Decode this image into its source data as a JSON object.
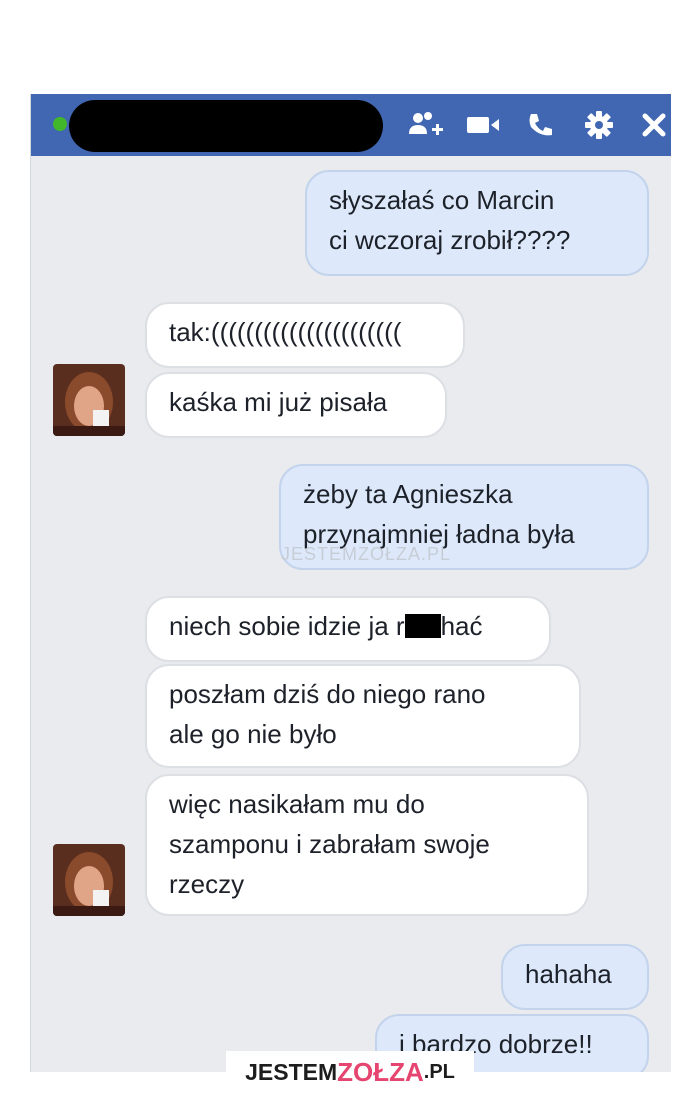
{
  "header": {
    "contact_name": "",
    "icons": [
      "add-person-icon",
      "video-call-icon",
      "phone-call-icon",
      "settings-gear-icon",
      "close-icon"
    ]
  },
  "messages": [
    {
      "side": "out",
      "lines": [
        "słyszałaś co Marcin",
        "ci wczoraj zrobił????"
      ]
    },
    {
      "side": "in",
      "lines": [
        "tak:(((((((((((((((((((((("
      ]
    },
    {
      "side": "in",
      "lines": [
        "kaśka mi już pisała"
      ]
    },
    {
      "side": "out",
      "lines": [
        "żeby ta Agnieszka",
        "przynajmniej ładna była"
      ]
    },
    {
      "side": "in",
      "lines": [
        "niech sobie idzie ja r",
        "hać"
      ]
    },
    {
      "side": "in",
      "lines": [
        "poszłam dziś do niego rano",
        "ale go nie było"
      ]
    },
    {
      "side": "in",
      "lines": [
        "więc nasikałam mu do",
        "szamponu i zabrałam swoje",
        "rzeczy"
      ]
    },
    {
      "side": "out",
      "lines": [
        "hahaha"
      ]
    },
    {
      "side": "out",
      "lines": [
        "i bardzo dobrze!!"
      ]
    }
  ],
  "watermark": "JESTEMZOŁZA.PL",
  "logo": {
    "left": "JESTEM",
    "accent": "ZOŁZA",
    "right": ".PL"
  },
  "colors": {
    "header": "#4267b2",
    "out_bubble": "#dde9fa",
    "in_bubble": "#ffffff",
    "background": "#e9ebee",
    "logo_accent": "#e5456e"
  }
}
